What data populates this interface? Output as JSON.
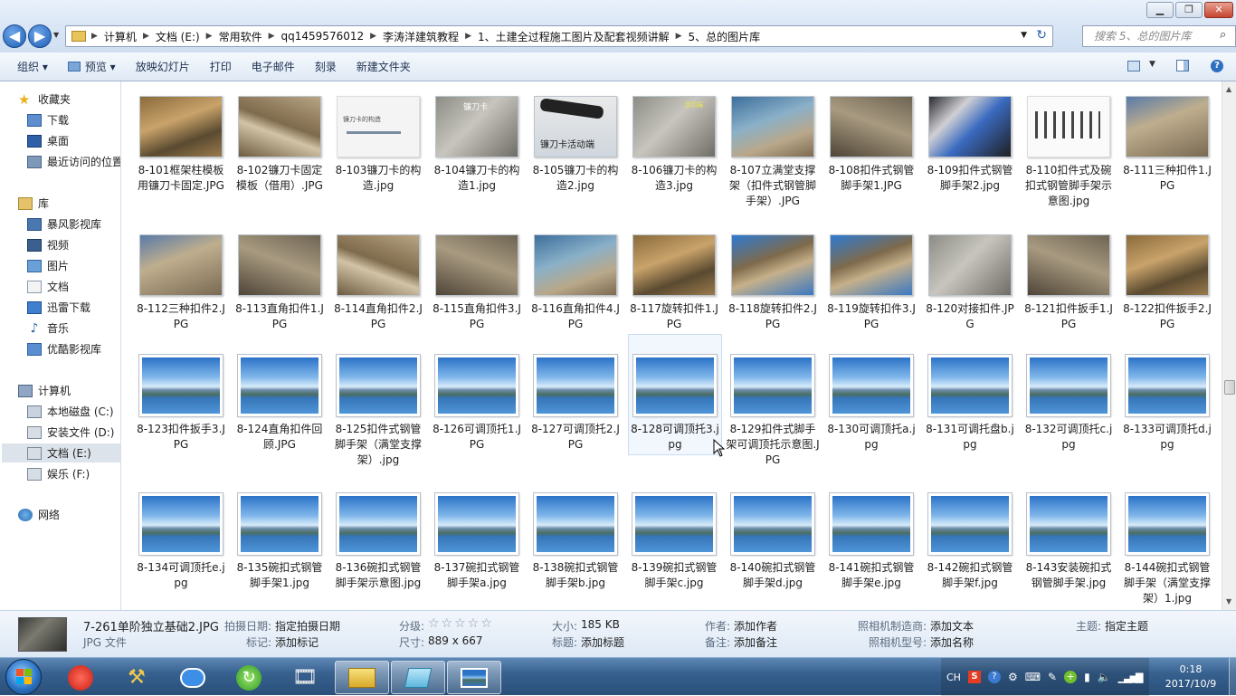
{
  "window": {
    "controls": {
      "minimize": "▁",
      "maximize": "❐",
      "close": "✕"
    }
  },
  "address": {
    "back": "◀",
    "forward": "▶",
    "crumbs": [
      "计算机",
      "文档 (E:)",
      "常用软件",
      "qq1459576012",
      "李涛洋建筑教程",
      "1、土建全过程施工图片及配套视频讲解",
      "5、总的图片库"
    ],
    "search_placeholder": "搜索 5、总的图片库"
  },
  "toolbar": {
    "organize": "组织 ▾",
    "preview": "预览 ▾",
    "slideshow": "放映幻灯片",
    "print": "打印",
    "email": "电子邮件",
    "burn": "刻录",
    "new_folder": "新建文件夹"
  },
  "sidebar": {
    "favorites": "收藏夹",
    "fav_items": [
      "下载",
      "桌面",
      "最近访问的位置"
    ],
    "libraries": "库",
    "lib_items": [
      "暴风影视库",
      "视频",
      "图片",
      "文档",
      "迅雷下载",
      "音乐",
      "优酷影视库"
    ],
    "computer": "计算机",
    "drives": [
      "本地磁盘 (C:)",
      "安装文件 (D:)",
      "文档 (E:)",
      "娱乐 (F:)"
    ],
    "network": "网络"
  },
  "files": {
    "row1": [
      "8-101框架柱模板用镰刀卡固定.JPG",
      "8-102镰刀卡固定模板（借用）.JPG",
      "8-103镰刀卡的构造.jpg",
      "8-104镰刀卡的构造1.jpg",
      "8-105镰刀卡的构造2.jpg",
      "8-106镰刀卡的构造3.jpg",
      "8-107立满堂支撑架（扣件式钢管脚手架）.JPG",
      "8-108扣件式钢管脚手架1.JPG",
      "8-109扣件式钢管脚手架2.jpg",
      "8-110扣件式及碗扣式钢管脚手架示意图.jpg",
      "8-111三种扣件1.JPG"
    ],
    "row2": [
      "8-112三种扣件2.JPG",
      "8-113直角扣件1.JPG",
      "8-114直角扣件2.JPG",
      "8-115直角扣件3.JPG",
      "8-116直角扣件4.JPG",
      "8-117旋转扣件1.JPG",
      "8-118旋转扣件2.JPG",
      "8-119旋转扣件3.JPG",
      "8-120对接扣件.JPG",
      "8-121扣件扳手1.JPG",
      "8-122扣件扳手2.JPG"
    ],
    "row3": [
      "8-123扣件扳手3.JPG",
      "8-124直角扣件回顾.JPG",
      "8-125扣件式钢管脚手架（满堂支撑架）.jpg",
      "8-126可调顶托1.JPG",
      "8-127可调顶托2.JPG",
      "8-128可调顶托3.jpg",
      "8-129扣件式脚手架可调顶托示意图.JPG",
      "8-130可调顶托a.jpg",
      "8-131可调托盘b.jpg",
      "8-132可调顶托c.jpg",
      "8-133可调顶托d.jpg"
    ],
    "row4": [
      "8-134可调顶托e.jpg",
      "8-135碗扣式钢管脚手架1.jpg",
      "8-136碗扣式钢管脚手架示意图.jpg",
      "8-137碗扣式钢管脚手架a.jpg",
      "8-138碗扣式钢管脚手架b.jpg",
      "8-139碗扣式钢管脚手架c.jpg",
      "8-140碗扣式钢管脚手架d.jpg",
      "8-141碗扣式钢管脚手架e.jpg",
      "8-142碗扣式钢管脚手架f.jpg",
      "8-143安装碗扣式钢管脚手架.jpg",
      "8-144碗扣式钢管脚手架（满堂支撑架）1.jpg"
    ],
    "thumb_captions": {
      "t103": "镰刀卡的构造",
      "t104": "镰刀卡",
      "t105": "镰刀卡活动端",
      "t106": "活动端"
    }
  },
  "details": {
    "filename": "7-261单阶独立基础2.JPG",
    "filetype": "JPG 文件",
    "date_k": "拍摄日期:",
    "date_v": "指定拍摄日期",
    "tags_k": "标记:",
    "tags_v": "添加标记",
    "rating_k": "分级:",
    "rating_v": "☆☆☆☆☆",
    "dims_k": "尺寸:",
    "dims_v": "889 x 667",
    "size_k": "大小:",
    "size_v": "185 KB",
    "title_k": "标题:",
    "title_v": "添加标题",
    "author_k": "作者:",
    "author_v": "添加作者",
    "comments_k": "备注:",
    "comments_v": "添加备注",
    "maker_k": "照相机制造商:",
    "maker_v": "添加文本",
    "model_k": "照相机型号:",
    "model_v": "添加名称",
    "subject_k": "主题:",
    "subject_v": "指定主题"
  },
  "taskbar": {
    "lang": "CH",
    "time": "0:18",
    "date": "2017/10/9"
  }
}
